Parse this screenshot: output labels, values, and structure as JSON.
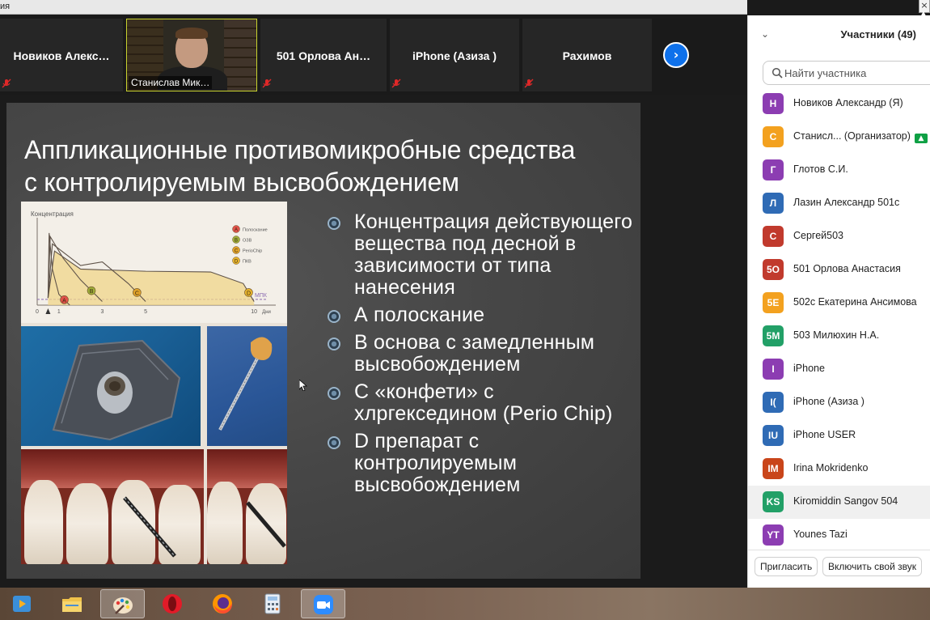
{
  "window": {
    "title_fragment": "ия",
    "close_label": "×"
  },
  "thumbnails": [
    {
      "name": "Новиков  Алекс…",
      "muted": true
    },
    {
      "name": "Станислав Мик…",
      "muted": false,
      "video": true
    },
    {
      "name": "501 Орлова  Ан…",
      "muted": true
    },
    {
      "name": "iPhone (Азиза )",
      "muted": true
    },
    {
      "name": "Рахимов",
      "muted": true
    }
  ],
  "next_button_label": "›",
  "slide": {
    "title_lines": [
      "Аппликационные противомикробные средства",
      "с контролируемым высвобождением"
    ],
    "bullets": [
      "Концентрация действующего вещества под десной в зависимости от типа нанесения",
      "А полоскание",
      "В основа с замедленным высвобождением",
      "С «конфети» с хлргекседином (Perio Chip)",
      "D препарат с контролируемым высвобождением"
    ]
  },
  "chart_data": {
    "type": "line",
    "ylabel": "Концентрация",
    "xlabel": "Дни",
    "x_ticks": [
      "0",
      "1",
      "3",
      "5",
      "10"
    ],
    "threshold_label": "МПК",
    "legend": [
      {
        "key": "A",
        "label": "Полоскание",
        "color": "#e0524a"
      },
      {
        "key": "B",
        "label": "OЗВ",
        "color": "#9fae3a"
      },
      {
        "key": "C",
        "label": "PerioChip",
        "color": "#e0a22a"
      },
      {
        "key": "D",
        "label": "ПКВ",
        "color": "#e6b32d"
      }
    ],
    "series": [
      {
        "name": "A",
        "x": [
          0.5,
          0.55,
          0.7,
          1.0,
          1.5
        ],
        "y": [
          0.1,
          1.0,
          0.5,
          0.15,
          0.0
        ]
      },
      {
        "name": "B",
        "x": [
          0.5,
          0.6,
          1.2,
          2.0,
          3.0
        ],
        "y": [
          0.1,
          0.95,
          0.65,
          0.35,
          0.05
        ]
      },
      {
        "name": "C",
        "x": [
          0.5,
          0.7,
          2.0,
          3.0,
          4.2,
          5.0
        ],
        "y": [
          0.1,
          0.85,
          0.55,
          0.6,
          0.3,
          0.05
        ]
      },
      {
        "name": "D",
        "x": [
          0.5,
          0.8,
          2.0,
          5.0,
          8.0,
          9.5,
          10.0
        ],
        "y": [
          0.1,
          0.75,
          0.5,
          0.47,
          0.46,
          0.3,
          0.05
        ]
      }
    ],
    "xlim": [
      0,
      11
    ],
    "ylim": [
      0,
      1.1
    ]
  },
  "panel": {
    "title": "Участники (49)",
    "search_placeholder": "Найти участника",
    "participants": [
      {
        "initials": "Н",
        "name": "Новиков Александр (Я)",
        "color": "#8c3db2"
      },
      {
        "initials": "С",
        "name": "Станисл... (Организатор)",
        "color": "#f3a11f",
        "sharing": true
      },
      {
        "initials": "Г",
        "name": "Глотов С.И.",
        "color": "#8c3db2"
      },
      {
        "initials": "Л",
        "name": "Лазин Александр 501с",
        "color": "#2f6bb5"
      },
      {
        "initials": "С",
        "name": "Сергей503",
        "color": "#c13a2d"
      },
      {
        "initials": "5О",
        "name": "501 Орлова Анастасия",
        "color": "#c13a2d"
      },
      {
        "initials": "5Е",
        "name": "502с Екатерина Ансимова",
        "color": "#f3a11f"
      },
      {
        "initials": "5М",
        "name": "503 Милюхин Н.А.",
        "color": "#22a067"
      },
      {
        "initials": "I",
        "name": "iPhone",
        "color": "#8c3db2"
      },
      {
        "initials": "I(",
        "name": "iPhone (Азиза )",
        "color": "#2f6bb5"
      },
      {
        "initials": "IU",
        "name": "iPhone USER",
        "color": "#2f6bb5"
      },
      {
        "initials": "IM",
        "name": "Irina Mokridenko",
        "color": "#c9451a"
      },
      {
        "initials": "KS",
        "name": "Kiromiddin Sangov 504",
        "color": "#22a067",
        "highlighted": true
      },
      {
        "initials": "YT",
        "name": "Younes Tazi",
        "color": "#8c3db2"
      }
    ],
    "invite_label": "Пригласить",
    "unmute_label": "Включить свой звук"
  },
  "taskbar": {
    "apps": [
      {
        "icon": "media-player-icon"
      },
      {
        "icon": "file-explorer-icon"
      },
      {
        "icon": "paint-icon",
        "active": true
      },
      {
        "icon": "opera-icon"
      },
      {
        "icon": "firefox-icon"
      },
      {
        "icon": "calculator-icon"
      },
      {
        "icon": "zoom-icon",
        "active": true
      }
    ]
  }
}
